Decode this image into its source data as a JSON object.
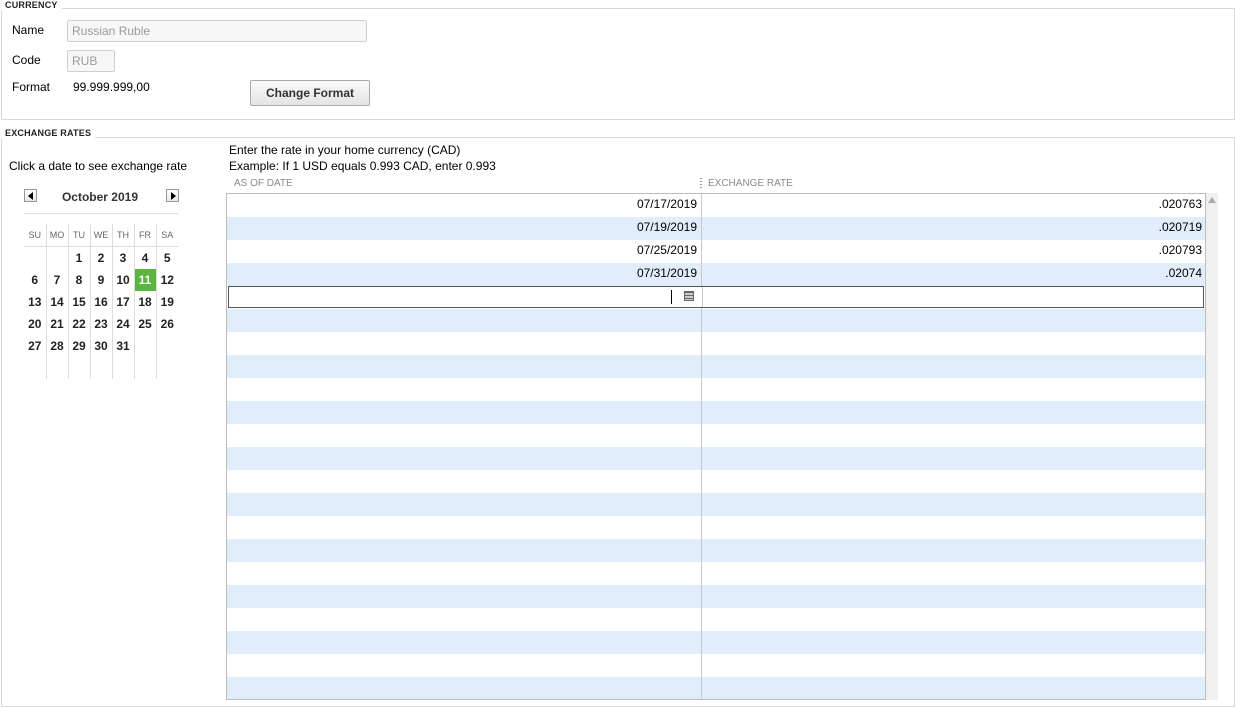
{
  "currency": {
    "section_title": "CURRENCY",
    "name_label": "Name",
    "name_value": "Russian Ruble",
    "code_label": "Code",
    "code_value": "RUB",
    "format_label": "Format",
    "format_value": "99.999.999,00",
    "change_format_button": "Change Format"
  },
  "exchange_rates": {
    "section_title": "EXCHANGE RATES",
    "calendar_hint": "Click a date to see exchange rate",
    "instruction_line1": "Enter the rate in your home currency (CAD)",
    "instruction_line2": "Example: If 1 USD equals 0.993 CAD, enter 0.993",
    "calendar": {
      "month_label": "October 2019",
      "weekdays": [
        "SU",
        "MO",
        "TU",
        "WE",
        "TH",
        "FR",
        "SA"
      ],
      "weeks": [
        [
          "",
          "",
          "1",
          "2",
          "3",
          "4",
          "5"
        ],
        [
          "6",
          "7",
          "8",
          "9",
          "10",
          "11",
          "12"
        ],
        [
          "13",
          "14",
          "15",
          "16",
          "17",
          "18",
          "19"
        ],
        [
          "20",
          "21",
          "22",
          "23",
          "24",
          "25",
          "26"
        ],
        [
          "27",
          "28",
          "29",
          "30",
          "31",
          "",
          ""
        ]
      ],
      "selected_day": "11",
      "selected_color": "#5ab53e"
    },
    "table": {
      "col_date": "AS OF DATE",
      "col_rate": "EXCHANGE RATE",
      "rows": [
        {
          "date": "07/17/2019",
          "rate": ".020763"
        },
        {
          "date": "07/19/2019",
          "rate": ".020719"
        },
        {
          "date": "07/25/2019",
          "rate": ".020793"
        },
        {
          "date": "07/31/2019",
          "rate": ".02074"
        }
      ],
      "stripe_color": "#e1edfb"
    }
  }
}
